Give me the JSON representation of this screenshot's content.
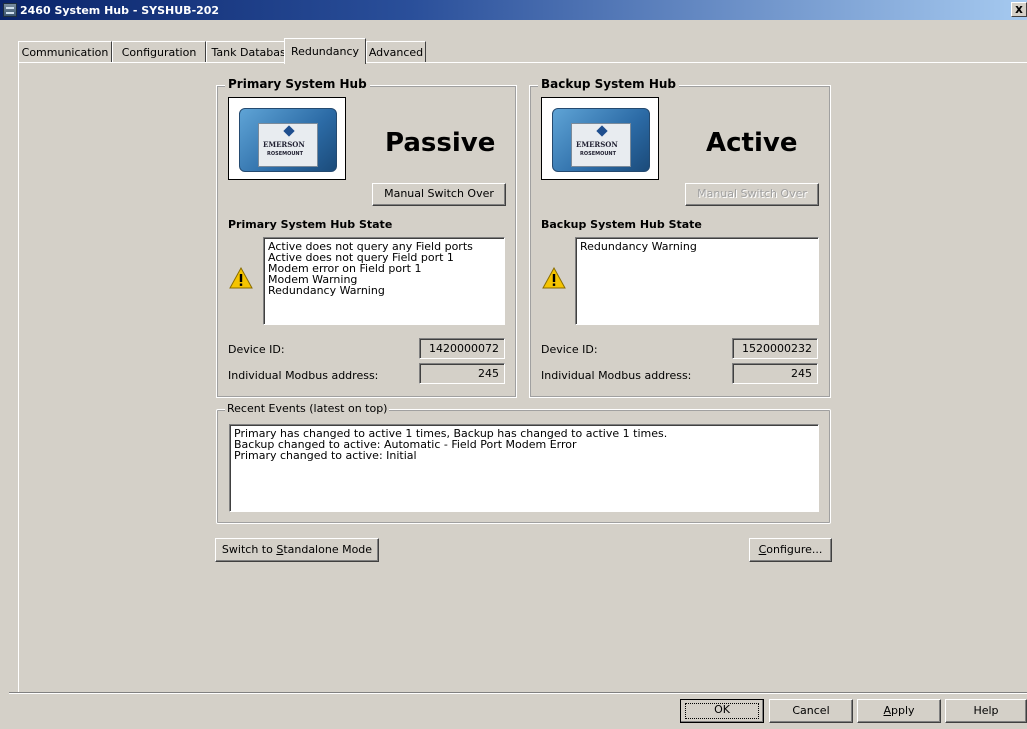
{
  "window": {
    "title": "2460 System Hub  - SYSHUB-202",
    "close_label": "x"
  },
  "tabs": [
    {
      "label": "Communication"
    },
    {
      "label": "Configuration"
    },
    {
      "label": "Tank Database"
    },
    {
      "label": "Redundancy"
    },
    {
      "label": "Advanced"
    }
  ],
  "active_tab": "Redundancy",
  "primary": {
    "group_title": "Primary System Hub",
    "status": "Passive",
    "switch_button": "Manual Switch Over",
    "switch_enabled": true,
    "state_label": "Primary System Hub State",
    "state_items": [
      "Active does not query any Field ports",
      "Active does not query Field port 1",
      "Modem error on Field port 1",
      "Modem Warning",
      "Redundancy Warning"
    ],
    "device_id_label": "Device ID:",
    "device_id": "1420000072",
    "modbus_label": "Individual Modbus address:",
    "modbus_address": "245"
  },
  "backup": {
    "group_title": "Backup System Hub",
    "status": "Active",
    "switch_button": "Manual Switch Over",
    "switch_enabled": false,
    "state_label": "Backup System Hub State",
    "state_items": [
      "Redundancy Warning"
    ],
    "device_id_label": "Device ID:",
    "device_id": "1520000232",
    "modbus_label": "Individual Modbus address:",
    "modbus_address": "245"
  },
  "device_image": {
    "brand": "EMERSON",
    "sub": "ROSEMOUNT"
  },
  "events": {
    "title": "Recent Events (latest on top)",
    "items": [
      "Primary has changed to active 1 times, Backup has changed to active 1 times.",
      "Backup changed to active: Automatic - Field Port Modem Error",
      "Primary changed to active: Initial"
    ]
  },
  "buttons": {
    "standalone_pre": "Switch to ",
    "standalone_hot": "S",
    "standalone_post": "tandalone Mode",
    "configure_hot": "C",
    "configure_post": "onfigure...",
    "ok": "OK",
    "cancel": "Cancel",
    "apply_hot": "A",
    "apply_post": "pply",
    "help": "Help"
  },
  "colors": {
    "dialog_bg": "#d4d0c8",
    "title_gradient_start": "#0a246a",
    "warning_yellow": "#f5c400"
  }
}
